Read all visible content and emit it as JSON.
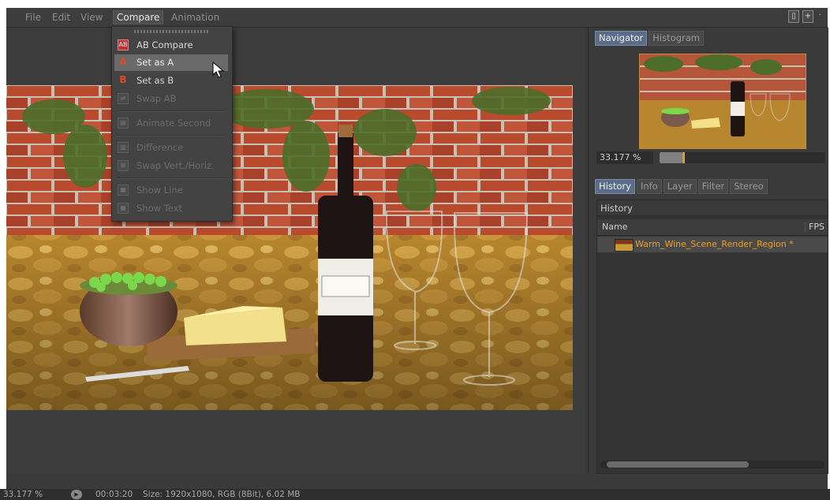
{
  "menu": {
    "items": [
      "File",
      "Edit",
      "View",
      "Compare",
      "Animation"
    ],
    "active": "Compare"
  },
  "compare_menu": {
    "items": [
      {
        "label": "AB Compare",
        "icon": "ab-compare-icon",
        "enabled": true
      },
      {
        "label": "Set as A",
        "icon": "set-a-icon",
        "enabled": true,
        "highlighted": true
      },
      {
        "label": "Set as B",
        "icon": "set-b-icon",
        "enabled": true
      },
      {
        "label": "Swap AB",
        "icon": "swap-ab-icon",
        "enabled": false
      },
      {
        "label": "Animate Second",
        "icon": "animate-second-icon",
        "enabled": false
      },
      {
        "label": "Difference",
        "icon": "difference-icon",
        "enabled": false
      },
      {
        "label": "Swap Vert./Horiz.",
        "icon": "swap-vert-horiz-icon",
        "enabled": false
      },
      {
        "label": "Show Line",
        "icon": "show-line-icon",
        "enabled": false
      },
      {
        "label": "Show Text",
        "icon": "show-text-icon",
        "enabled": false
      }
    ]
  },
  "navigator": {
    "tabs": [
      "Navigator",
      "Histogram"
    ],
    "active_tab": "Navigator",
    "zoom": "33.177 %",
    "zoom_fraction": 0.14
  },
  "history_panel": {
    "tabs": [
      "History",
      "Info",
      "Layer",
      "Filter",
      "Stereo"
    ],
    "active_tab": "History",
    "title": "History",
    "columns": [
      "Name",
      "FPS"
    ],
    "rows": [
      {
        "name": "Warm_Wine_Scene_Render_Region *",
        "fps": ""
      }
    ]
  },
  "status": {
    "zoom": "33.177 %",
    "time": "00:03:20",
    "info": "Size: 1920x1080, RGB (8Bit), 6.02 MB"
  },
  "colors": {
    "accent": "#f0a020",
    "tab_active": "#5b6c86",
    "menu_highlight": "#6a6a6a"
  }
}
